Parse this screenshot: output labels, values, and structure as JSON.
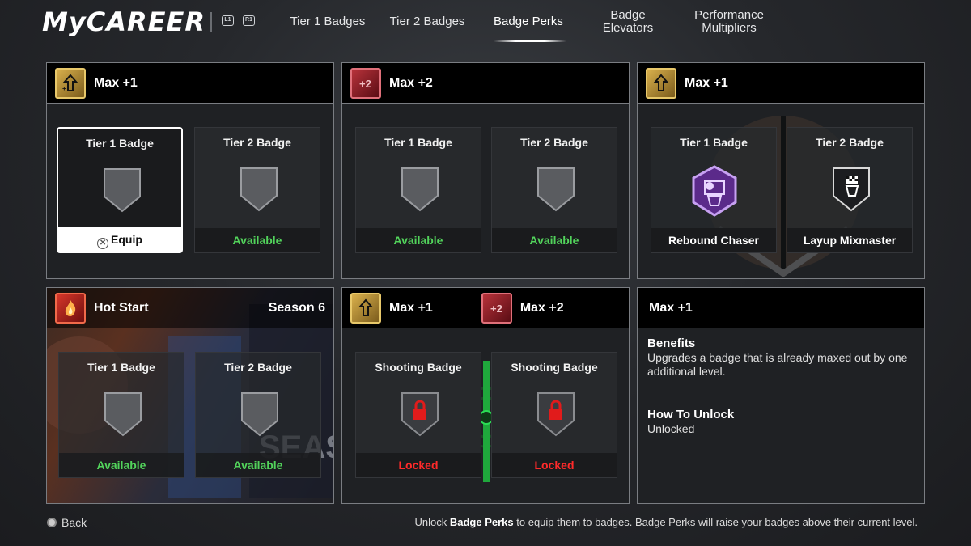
{
  "header": {
    "logo": "MyCAREER",
    "shoulder_left": "L1",
    "shoulder_right": "R1",
    "tabs": [
      {
        "label": "Tier 1 Badges"
      },
      {
        "label": "Tier 2 Badges"
      },
      {
        "label": "Badge Perks"
      },
      {
        "label": "Badge Elevators"
      },
      {
        "label": "Performance Multipliers"
      }
    ]
  },
  "cards": {
    "c1": {
      "title": "Max +1",
      "icon": "max-plus-1-icon",
      "slots": [
        {
          "title": "Tier 1 Badge",
          "status": "Equip",
          "icon": "button-cross-icon"
        },
        {
          "title": "Tier 2 Badge",
          "status": "Available"
        }
      ]
    },
    "c2": {
      "title": "Max +2",
      "icon": "max-plus-2-icon",
      "slots": [
        {
          "title": "Tier 1 Badge",
          "status": "Available"
        },
        {
          "title": "Tier 2 Badge",
          "status": "Available"
        }
      ]
    },
    "c3": {
      "title": "Max +1",
      "icon": "max-plus-1-icon",
      "slots": [
        {
          "title": "Tier 1 Badge",
          "status": "Rebound Chaser",
          "icon": "rebound-chaser-icon"
        },
        {
          "title": "Tier 2 Badge",
          "status": "Layup Mixmaster",
          "icon": "layup-mixmaster-icon"
        }
      ]
    },
    "c4": {
      "title": "Hot Start",
      "subtitle": "Season 6",
      "icon": "fire-icon",
      "slots": [
        {
          "title": "Tier 1 Badge",
          "status": "Available"
        },
        {
          "title": "Tier 2 Badge",
          "status": "Available"
        }
      ]
    },
    "c5": {
      "title_left": "Max +1",
      "title_right": "Max +2",
      "slots": [
        {
          "title": "Shooting Badge",
          "status": "Locked",
          "icon": "lock-icon"
        },
        {
          "title": "Shooting Badge",
          "status": "Locked",
          "icon": "lock-icon"
        }
      ]
    },
    "c6": {
      "title": "Max +1",
      "benefits_heading": "Benefits",
      "benefits_text": "Upgrades a badge that is already maxed out by one additional level.",
      "unlock_heading": "How To Unlock",
      "unlock_text": "Unlocked"
    }
  },
  "footer": {
    "back_label": "Back",
    "hint_prefix": "Unlock",
    "hint_bold": "Badge Perks",
    "hint_suffix": "to equip them to badges. Badge Perks will raise your badges above their current level."
  },
  "colors": {
    "available": "#52d35b",
    "locked": "#ff2a2a",
    "unlocked": "#52d35b"
  }
}
